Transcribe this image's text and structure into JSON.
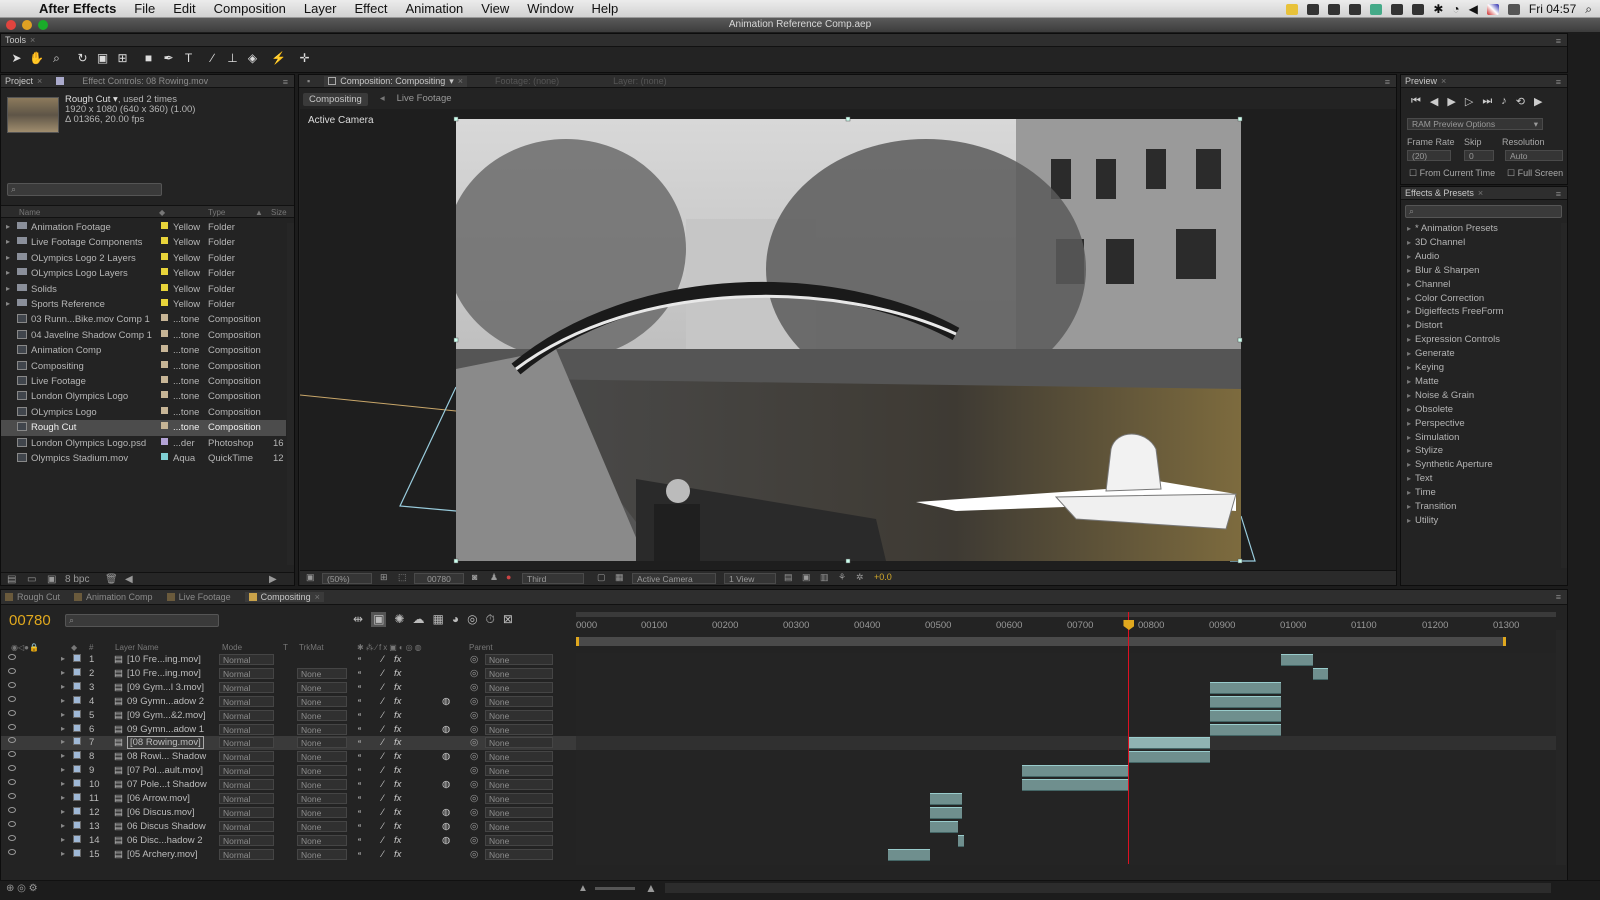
{
  "menubar": {
    "app": "After Effects",
    "items": [
      "File",
      "Edit",
      "Composition",
      "Layer",
      "Effect",
      "Animation",
      "View",
      "Window",
      "Help"
    ],
    "clock": "Fri 04:57"
  },
  "window_title": "Animation Reference Comp.aep",
  "tools_panel": {
    "tab": "Tools"
  },
  "project": {
    "tabs": [
      "Project",
      "Effect Controls: 08 Rowing.mov"
    ],
    "selected_name": "Rough Cut ▾",
    "used": ", used 2 times",
    "dims": "1920 x 1080  (640 x 360) (1.00)",
    "duration": "Δ 01366, 20.00 fps",
    "columns": [
      "Name",
      "Type",
      "Size"
    ],
    "bpc": "8 bpc",
    "items": [
      {
        "name": "Animation Footage",
        "label": "Yellow",
        "type": "Folder",
        "size": "",
        "kind": "folder",
        "color": "#e8d43a"
      },
      {
        "name": "Live Footage Components",
        "label": "Yellow",
        "type": "Folder",
        "size": "",
        "kind": "folder",
        "color": "#e8d43a"
      },
      {
        "name": "OLympics Logo 2 Layers",
        "label": "Yellow",
        "type": "Folder",
        "size": "",
        "kind": "folder",
        "color": "#e8d43a"
      },
      {
        "name": "OLympics Logo Layers",
        "label": "Yellow",
        "type": "Folder",
        "size": "",
        "kind": "folder",
        "color": "#e8d43a"
      },
      {
        "name": "Solids",
        "label": "Yellow",
        "type": "Folder",
        "size": "",
        "kind": "folder",
        "color": "#e8d43a"
      },
      {
        "name": "Sports Reference",
        "label": "Yellow",
        "type": "Folder",
        "size": "",
        "kind": "folder",
        "color": "#e8d43a"
      },
      {
        "name": "03 Runn...Bike.mov Comp 1",
        "label": "...tone",
        "type": "Composition",
        "size": "",
        "kind": "comp",
        "color": "#c7b596"
      },
      {
        "name": "04 Javeline Shadow Comp 1",
        "label": "...tone",
        "type": "Composition",
        "size": "",
        "kind": "comp",
        "color": "#c7b596"
      },
      {
        "name": "Animation Comp",
        "label": "...tone",
        "type": "Composition",
        "size": "",
        "kind": "comp",
        "color": "#c7b596"
      },
      {
        "name": "Compositing",
        "label": "...tone",
        "type": "Composition",
        "size": "",
        "kind": "comp",
        "color": "#c7b596"
      },
      {
        "name": "Live Footage",
        "label": "...tone",
        "type": "Composition",
        "size": "",
        "kind": "comp",
        "color": "#c7b596"
      },
      {
        "name": "London Olympics Logo",
        "label": "...tone",
        "type": "Composition",
        "size": "",
        "kind": "comp",
        "color": "#c7b596"
      },
      {
        "name": "OLympics Logo",
        "label": "...tone",
        "type": "Composition",
        "size": "",
        "kind": "comp",
        "color": "#c7b596"
      },
      {
        "name": "Rough Cut",
        "label": "...tone",
        "type": "Composition",
        "size": "",
        "kind": "comp",
        "color": "#c7b596",
        "selected": true
      },
      {
        "name": "London Olympics Logo.psd",
        "label": "...der",
        "type": "Photoshop",
        "size": "16",
        "kind": "psd",
        "color": "#b3a3d6"
      },
      {
        "name": "Olympics Stadium.mov",
        "label": "Aqua",
        "type": "QuickTime",
        "size": "12",
        "kind": "mov",
        "color": "#7fd0d4"
      }
    ]
  },
  "comp_panel": {
    "tabs": [
      "Composition: Compositing",
      "Footage: (none)",
      "Layer: (none)"
    ],
    "subtabs": [
      "Compositing",
      "Live Footage"
    ],
    "view_label": "Active Camera",
    "footer": {
      "zoom": "(50%)",
      "time": "00780",
      "resolution": "Third",
      "camera": "Active Camera",
      "views": "1 View",
      "exposure": "+0.0"
    }
  },
  "preview": {
    "tab": "Preview",
    "ram": "RAM Preview Options",
    "frame_rate_label": "Frame Rate",
    "skip_label": "Skip",
    "resolution_label": "Resolution",
    "frame_rate": "(20)",
    "skip": "0",
    "resolution": "Auto",
    "from_current": "From Current Time",
    "full_screen": "Full Screen"
  },
  "effects": {
    "tab": "Effects & Presets",
    "items": [
      "* Animation Presets",
      "3D Channel",
      "Audio",
      "Blur & Sharpen",
      "Channel",
      "Color Correction",
      "Digieffects FreeForm",
      "Distort",
      "Expression Controls",
      "Generate",
      "Keying",
      "Matte",
      "Noise & Grain",
      "Obsolete",
      "Perspective",
      "Simulation",
      "Stylize",
      "Synthetic Aperture",
      "Text",
      "Time",
      "Transition",
      "Utility"
    ]
  },
  "timeline": {
    "tabs": [
      "Rough Cut",
      "Animation Comp",
      "Live Footage",
      "Compositing"
    ],
    "timecode": "00780",
    "headers": {
      "layer": "Layer Name",
      "mode": "Mode",
      "t": "T",
      "trkmat": "TrkMat",
      "parent": "Parent"
    },
    "ruler": [
      "0000",
      "00100",
      "00200",
      "00300",
      "00400",
      "00500",
      "00600",
      "00700",
      "00800",
      "00900",
      "01000",
      "01100",
      "01200",
      "01300"
    ],
    "layers": [
      {
        "n": "1",
        "name": "[10 Fre...ing.mov]",
        "mode": "Normal",
        "trk": "",
        "parent": "None",
        "start": 995,
        "end": 1040
      },
      {
        "n": "2",
        "name": "[10 Fre...ing.mov]",
        "mode": "Normal",
        "trk": "None",
        "parent": "None",
        "start": 1040,
        "end": 1062
      },
      {
        "n": "3",
        "name": "[09 Gym...l 3.mov]",
        "mode": "Normal",
        "trk": "None",
        "parent": "None",
        "start": 895,
        "end": 995
      },
      {
        "n": "4",
        "name": "09 Gymn...adow 2",
        "mode": "Normal",
        "trk": "None",
        "parent": "None",
        "start": 895,
        "end": 995
      },
      {
        "n": "5",
        "name": "[09 Gym...&2.mov]",
        "mode": "Normal",
        "trk": "None",
        "parent": "None",
        "start": 895,
        "end": 995
      },
      {
        "n": "6",
        "name": "09 Gymn...adow 1",
        "mode": "Normal",
        "trk": "None",
        "parent": "None",
        "start": 895,
        "end": 995
      },
      {
        "n": "7",
        "name": "[08 Rowing.mov]",
        "mode": "Normal",
        "trk": "None",
        "parent": "None",
        "start": 780,
        "end": 895,
        "selected": true
      },
      {
        "n": "8",
        "name": "08 Rowi... Shadow",
        "mode": "Normal",
        "trk": "None",
        "parent": "None",
        "start": 780,
        "end": 895
      },
      {
        "n": "9",
        "name": "[07 Pol...ault.mov]",
        "mode": "Normal",
        "trk": "None",
        "parent": "None",
        "start": 630,
        "end": 780
      },
      {
        "n": "10",
        "name": "07 Pole...t Shadow",
        "mode": "Normal",
        "trk": "None",
        "parent": "None",
        "start": 630,
        "end": 780
      },
      {
        "n": "11",
        "name": "[06 Arrow.mov]",
        "mode": "Normal",
        "trk": "None",
        "parent": "None",
        "start": 500,
        "end": 545
      },
      {
        "n": "12",
        "name": "[06 Discus.mov]",
        "mode": "Normal",
        "trk": "None",
        "parent": "None",
        "start": 500,
        "end": 545
      },
      {
        "n": "13",
        "name": "06 Discus Shadow",
        "mode": "Normal",
        "trk": "None",
        "parent": "None",
        "start": 500,
        "end": 540
      },
      {
        "n": "14",
        "name": "06 Disc...hadow 2",
        "mode": "Normal",
        "trk": "None",
        "parent": "None",
        "start": 540,
        "end": 548
      },
      {
        "n": "15",
        "name": "[05 Archery.mov]",
        "mode": "Normal",
        "trk": "None",
        "parent": "None",
        "start": 440,
        "end": 500
      }
    ]
  },
  "colors": {
    "timecode": "#e0a81e",
    "cti": "#dd1122",
    "bar": "#6f8f8e"
  }
}
